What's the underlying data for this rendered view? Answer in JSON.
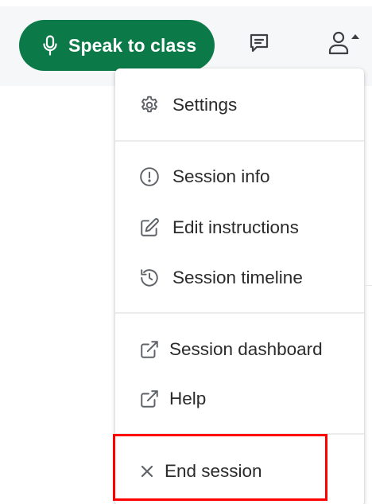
{
  "toolbar": {
    "speak_button_label": "Speak to class",
    "speak_button_icon": "microphone-icon",
    "chat_icon": "chat-icon",
    "people_icon": "people-icon"
  },
  "menu": {
    "sections": [
      {
        "items": [
          {
            "label": "Settings",
            "icon": "gear-icon"
          }
        ]
      },
      {
        "items": [
          {
            "label": "Session info",
            "icon": "info-icon"
          },
          {
            "label": "Edit instructions",
            "icon": "edit-icon"
          },
          {
            "label": "Session timeline",
            "icon": "history-icon"
          }
        ]
      },
      {
        "items": [
          {
            "label": "Session dashboard",
            "icon": "external-link-icon"
          },
          {
            "label": "Help",
            "icon": "external-link-icon"
          }
        ]
      },
      {
        "items": [
          {
            "label": "End session",
            "icon": "close-icon"
          }
        ]
      }
    ]
  },
  "colors": {
    "primary": "#0b7a48",
    "highlight": "#ff0000",
    "text": "#2b2b2b",
    "icon": "#5f6368"
  }
}
